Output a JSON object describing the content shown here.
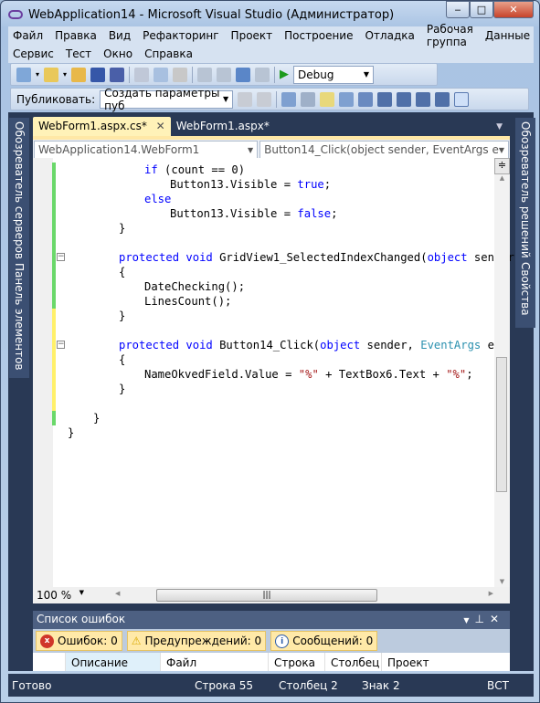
{
  "window": {
    "title": "WebApplication14 - Microsoft Visual Studio (Администратор)",
    "minimize": "‒",
    "maximize": "□",
    "close": "✕"
  },
  "menu": {
    "row1": [
      "Файл",
      "Правка",
      "Вид",
      "Рефакторинг",
      "Проект",
      "Построение",
      "Отладка",
      "Рабочая группа",
      "Данные"
    ],
    "row2": [
      "Сервис",
      "Тест",
      "Окно",
      "Справка"
    ]
  },
  "toolbar": {
    "config": "Debug",
    "publish_label": "Публиковать:",
    "publish_value": "Создать параметры пуб"
  },
  "side_left": [
    "Обозреватель серверов",
    "Панель элементов"
  ],
  "side_right": [
    "Обозреватель решений",
    "Свойства"
  ],
  "tabs": [
    {
      "label": "WebForm1.aspx.cs*",
      "close": "✕"
    },
    {
      "label": "WebForm1.aspx*"
    }
  ],
  "nav": {
    "class": "WebApplication14.WebForm1",
    "member": "Button14_Click(object sender, EventArgs e"
  },
  "code": [
    {
      "indent": 3,
      "bar": "g",
      "tokens": [
        [
          "kw",
          "if"
        ],
        [
          "pl",
          " (count == 0)"
        ]
      ]
    },
    {
      "indent": 4,
      "bar": "g",
      "tokens": [
        [
          "pl",
          "Button13.Visible = "
        ],
        [
          "kw",
          "true"
        ],
        [
          "pl",
          ";"
        ]
      ]
    },
    {
      "indent": 3,
      "bar": "g",
      "tokens": [
        [
          "kw",
          "else"
        ]
      ]
    },
    {
      "indent": 4,
      "bar": "g",
      "tokens": [
        [
          "pl",
          "Button13.Visible = "
        ],
        [
          "kw",
          "false"
        ],
        [
          "pl",
          ";"
        ]
      ]
    },
    {
      "indent": 2,
      "bar": "g",
      "tokens": [
        [
          "pl",
          "}"
        ]
      ]
    },
    {
      "indent": 0,
      "bar": "g",
      "tokens": []
    },
    {
      "indent": 2,
      "bar": "g",
      "fold": true,
      "tokens": [
        [
          "kw",
          "protected"
        ],
        [
          "pl",
          " "
        ],
        [
          "kw",
          "void"
        ],
        [
          "pl",
          " GridView1_SelectedIndexChanged("
        ],
        [
          "kw",
          "object"
        ],
        [
          "pl",
          " sender"
        ]
      ]
    },
    {
      "indent": 2,
      "bar": "g",
      "tokens": [
        [
          "pl",
          "{"
        ]
      ]
    },
    {
      "indent": 3,
      "bar": "g",
      "tokens": [
        [
          "pl",
          "DateChecking();"
        ]
      ]
    },
    {
      "indent": 3,
      "bar": "g",
      "tokens": [
        [
          "pl",
          "LinesCount();"
        ]
      ]
    },
    {
      "indent": 2,
      "bar": "y",
      "tokens": [
        [
          "pl",
          "}"
        ]
      ]
    },
    {
      "indent": 0,
      "bar": "y",
      "tokens": []
    },
    {
      "indent": 2,
      "bar": "y",
      "fold": true,
      "tokens": [
        [
          "kw",
          "protected"
        ],
        [
          "pl",
          " "
        ],
        [
          "kw",
          "void"
        ],
        [
          "pl",
          " Button14_Click("
        ],
        [
          "kw",
          "object"
        ],
        [
          "pl",
          " sender, "
        ],
        [
          "ty",
          "EventArgs"
        ],
        [
          "pl",
          " e)"
        ]
      ]
    },
    {
      "indent": 2,
      "bar": "y",
      "tokens": [
        [
          "pl",
          "{"
        ]
      ]
    },
    {
      "indent": 3,
      "bar": "y",
      "tokens": [
        [
          "pl",
          "NameOkvedField.Value = "
        ],
        [
          "st",
          "\"%\""
        ],
        [
          "pl",
          " + TextBox6.Text + "
        ],
        [
          "st",
          "\"%\""
        ],
        [
          "pl",
          ";"
        ]
      ]
    },
    {
      "indent": 2,
      "bar": "y",
      "tokens": [
        [
          "pl",
          "}"
        ]
      ]
    },
    {
      "indent": 0,
      "bar": "y",
      "tokens": []
    },
    {
      "indent": 1,
      "bar": "g",
      "tokens": [
        [
          "pl",
          "}"
        ]
      ]
    },
    {
      "indent": 0,
      "bar": "",
      "tokens": [
        [
          "pl",
          "}"
        ]
      ]
    }
  ],
  "zoom": "100 %",
  "error_list": {
    "title": "Список ошибок",
    "errors": "Ошибок: 0",
    "warnings": "Предупреждений: 0",
    "messages": "Сообщений: 0",
    "columns": [
      "",
      "Описание",
      "Файл",
      "Строка",
      "Столбец",
      "Проект"
    ]
  },
  "status": {
    "ready": "Готово",
    "line": "Строка 55",
    "col": "Столбец 2",
    "char": "Знак 2",
    "mode": "ВСТ"
  },
  "colors": {
    "keyword": "#0000ff",
    "type": "#2b91af",
    "string": "#a31515",
    "bar_green": "#6ad86a",
    "bar_yellow": "#fff06a",
    "chrome": "#293955"
  }
}
